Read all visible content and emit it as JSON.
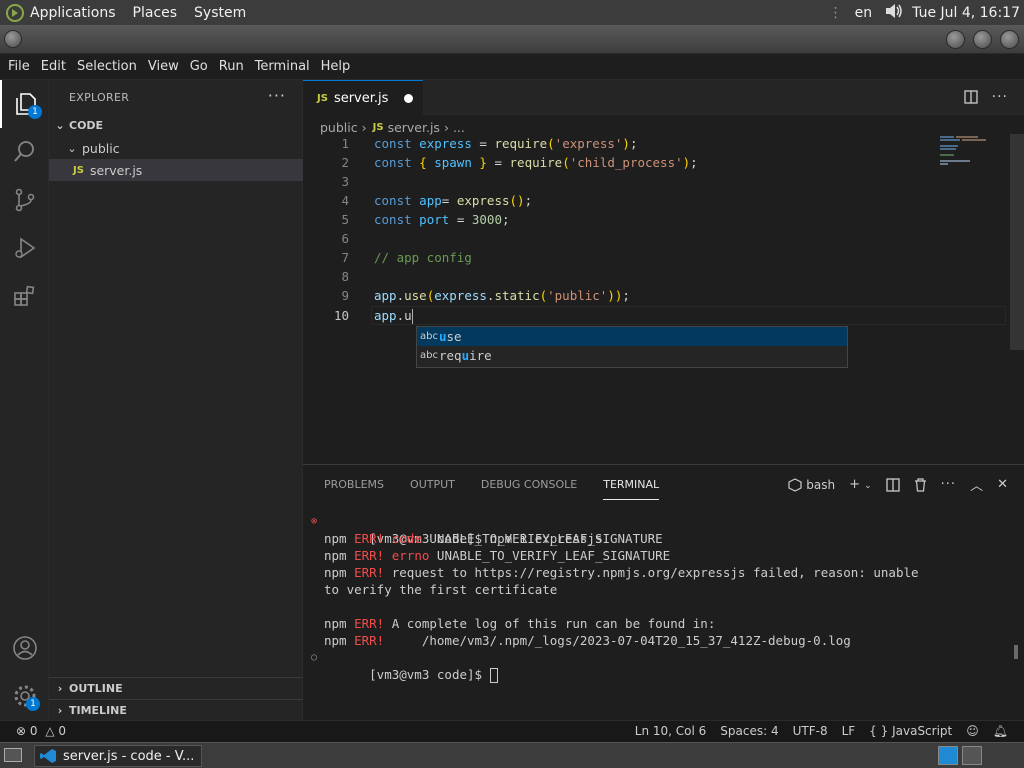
{
  "topbar": {
    "menus": [
      "Applications",
      "Places",
      "System"
    ],
    "lang": "en",
    "clock": "Tue Jul 4, 16:17"
  },
  "menubar": [
    "File",
    "Edit",
    "Selection",
    "View",
    "Go",
    "Run",
    "Terminal",
    "Help"
  ],
  "activity": {
    "explorer_badge": "1",
    "settings_badge": "1"
  },
  "sidebar": {
    "title": "EXPLORER",
    "more": "···",
    "root": "CODE",
    "folder": "public",
    "file": "server.js",
    "file_badge": "JS",
    "outline": "OUTLINE",
    "timeline": "TIMELINE"
  },
  "editor": {
    "tab_label": "server.js",
    "breadcrumb_folder": "public",
    "breadcrumb_file": "server.js",
    "breadcrumb_more": "...",
    "line_numbers": [
      "1",
      "2",
      "3",
      "4",
      "5",
      "6",
      "7",
      "8",
      "9",
      "10"
    ]
  },
  "suggest": {
    "kind": "abc",
    "items": [
      {
        "pre": "",
        "hl": "u",
        "post": "se"
      },
      {
        "pre": "req",
        "hl": "u",
        "post": "ire"
      }
    ]
  },
  "panel": {
    "tabs": [
      "PROBLEMS",
      "OUTPUT",
      "DEBUG CONSOLE",
      "TERMINAL"
    ],
    "shell": "bash",
    "terminal": {
      "cmd_prompt": "[vm3@vm3 code]$ ",
      "cmd": "npm i expressjs",
      "npm": "npm",
      "err": "ERR!",
      "code_key": "code",
      "code_val": " UNABLE_TO_VERIFY_LEAF_SIGNATURE",
      "errno_key": "errno",
      "errno_val": " UNABLE_TO_VERIFY_LEAF_SIGNATURE",
      "req1": " request to https://registry.npmjs.org/expressjs failed, reason: unable",
      "req2": "to verify the first certificate",
      "log1": " A complete log of this run can be found in:",
      "log2": "     /home/vm3/.npm/_logs/2023-07-04T20_15_37_412Z-debug-0.log",
      "prompt2": "[vm3@vm3 code]$ "
    }
  },
  "status": {
    "errors": "0",
    "warnings": "0",
    "position": "Ln 10, Col 6",
    "spaces": "Spaces: 4",
    "encoding": "UTF-8",
    "eol": "LF",
    "language": "JavaScript"
  },
  "taskbar": {
    "window_label": "server.js - code - V..."
  }
}
